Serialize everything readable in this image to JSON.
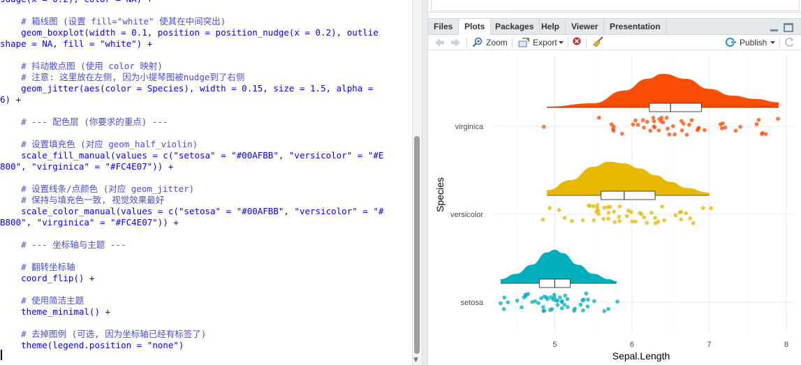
{
  "editor": {
    "lines": [
      {
        "text": "sudge(x = 0.2), color = NA) +",
        "kind": "code"
      },
      {
        "text": "",
        "kind": "code"
      },
      {
        "text": "    # 箱线图 (设置 fill=\"white\" 使其在中间突出)",
        "kind": "comment"
      },
      {
        "text": "    geom_boxplot(width = 0.1, position = position_nudge(x = 0.2), outlie",
        "kind": "code"
      },
      {
        "text": "shape = NA, fill = \"white\") +",
        "kind": "code"
      },
      {
        "text": "",
        "kind": "code"
      },
      {
        "text": "    # 抖动散点图 (使用 color 映射)",
        "kind": "comment"
      },
      {
        "text": "    # 注意: 这里放在左侧, 因为小提琴图被nudge到了右侧",
        "kind": "comment"
      },
      {
        "text": "    geom_jitter(aes(color = Species), width = 0.15, size = 1.5, alpha =",
        "kind": "code"
      },
      {
        "text": "6) +",
        "kind": "code"
      },
      {
        "text": "",
        "kind": "code"
      },
      {
        "text": "    # --- 配色层 (你要求的重点) ---",
        "kind": "comment"
      },
      {
        "text": "",
        "kind": "code"
      },
      {
        "text": "    # 设置填充色 (对应 geom_half_violin)",
        "kind": "comment"
      },
      {
        "text": "    scale_fill_manual(values = c(\"setosa\" = \"#00AFBB\", \"versicolor\" = \"#E",
        "kind": "code"
      },
      {
        "text": "800\", \"virginica\" = \"#FC4E07\")) +",
        "kind": "code"
      },
      {
        "text": "",
        "kind": "code"
      },
      {
        "text": "    # 设置线条/点颜色 (对应 geom_jitter)",
        "kind": "comment"
      },
      {
        "text": "    # 保持与填充色一致, 视觉效果最好",
        "kind": "comment"
      },
      {
        "text": "    scale_color_manual(values = c(\"setosa\" = \"#00AFBB\", \"versicolor\" = \"#",
        "kind": "code"
      },
      {
        "text": "B800\", \"virginica\" = \"#FC4E07\")) +",
        "kind": "code"
      },
      {
        "text": "",
        "kind": "code"
      },
      {
        "text": "    # --- 坐标轴与主题 ---",
        "kind": "comment"
      },
      {
        "text": "",
        "kind": "code"
      },
      {
        "text": "    # 翻转坐标轴",
        "kind": "comment"
      },
      {
        "text": "    coord_flip() +",
        "kind": "code"
      },
      {
        "text": "",
        "kind": "code"
      },
      {
        "text": "    # 使用简洁主题",
        "kind": "comment"
      },
      {
        "text": "    theme_minimal() +",
        "kind": "code"
      },
      {
        "text": "",
        "kind": "code"
      },
      {
        "text": "    # 去掉图例 (可选, 因为坐标轴已经有标签了)",
        "kind": "comment"
      },
      {
        "text": "    theme(legend.position = \"none\")",
        "kind": "code"
      }
    ]
  },
  "tabs": [
    {
      "label": "Files",
      "active": false
    },
    {
      "label": "Plots",
      "active": true
    },
    {
      "label": "Packages",
      "active": false
    },
    {
      "label": "Help",
      "active": false
    },
    {
      "label": "Viewer",
      "active": false
    },
    {
      "label": "Presentation",
      "active": false
    }
  ],
  "toolbar": {
    "zoom_label": "Zoom",
    "export_label": "Export",
    "publish_label": "Publish"
  },
  "icons": {
    "back": "arrow-left-icon",
    "forward": "arrow-right-icon",
    "zoom": "magnifier-icon",
    "export": "export-icon",
    "remove": "remove-plot-icon",
    "clear": "broom-icon",
    "publish": "publish-icon",
    "refresh": "refresh-icon",
    "minimize": "minimize-icon",
    "maximize": "maximize-icon"
  },
  "colors": {
    "setosa": "#00AFBB",
    "versicolor": "#E7B800",
    "virginica": "#FC4E07",
    "code": "#0000ff",
    "comment": "#4b4bd8"
  },
  "chart_data": {
    "type": "raincloud",
    "xlabel": "Sepal.Length",
    "ylabel": "Species",
    "xlim": [
      4.2,
      8.1
    ],
    "x_ticks": [
      5,
      6,
      7,
      8
    ],
    "grid": true,
    "legend": "none",
    "categories": [
      "setosa",
      "versicolor",
      "virginica"
    ],
    "series": [
      {
        "name": "setosa",
        "color": "#00AFBB",
        "violin": {
          "x": [
            4.3,
            4.5,
            4.7,
            4.9,
            5.0,
            5.1,
            5.3,
            5.5,
            5.7,
            5.8
          ],
          "density": [
            0.12,
            0.28,
            0.55,
            0.92,
            1.0,
            0.9,
            0.55,
            0.28,
            0.12,
            0.06
          ]
        },
        "box": {
          "q1": 4.8,
          "median": 5.0,
          "q3": 5.2
        },
        "points": [
          4.3,
          4.4,
          4.4,
          4.4,
          4.5,
          4.6,
          4.6,
          4.6,
          4.6,
          4.7,
          4.7,
          4.8,
          4.8,
          4.8,
          4.8,
          4.8,
          4.9,
          4.9,
          4.9,
          4.9,
          5.0,
          5.0,
          5.0,
          5.0,
          5.0,
          5.0,
          5.0,
          5.0,
          5.1,
          5.1,
          5.1,
          5.1,
          5.1,
          5.1,
          5.1,
          5.1,
          5.2,
          5.2,
          5.2,
          5.3,
          5.4,
          5.4,
          5.4,
          5.4,
          5.4,
          5.5,
          5.5,
          5.7,
          5.7,
          5.8
        ]
      },
      {
        "name": "versicolor",
        "color": "#E7B800",
        "violin": {
          "x": [
            4.9,
            5.2,
            5.5,
            5.7,
            5.9,
            6.1,
            6.3,
            6.5,
            6.7,
            7.0
          ],
          "density": [
            0.15,
            0.45,
            0.85,
            1.0,
            0.95,
            0.8,
            0.6,
            0.4,
            0.22,
            0.08
          ]
        },
        "box": {
          "q1": 5.6,
          "median": 5.9,
          "q3": 6.3
        },
        "points": [
          4.9,
          5.0,
          5.0,
          5.1,
          5.2,
          5.4,
          5.5,
          5.5,
          5.5,
          5.5,
          5.5,
          5.6,
          5.6,
          5.6,
          5.6,
          5.6,
          5.7,
          5.7,
          5.7,
          5.7,
          5.7,
          5.8,
          5.8,
          5.8,
          5.9,
          5.9,
          6.0,
          6.0,
          6.0,
          6.0,
          6.1,
          6.1,
          6.1,
          6.1,
          6.2,
          6.2,
          6.3,
          6.3,
          6.3,
          6.4,
          6.4,
          6.5,
          6.6,
          6.6,
          6.7,
          6.7,
          6.7,
          6.8,
          6.9,
          7.0
        ]
      },
      {
        "name": "virginica",
        "color": "#FC4E07",
        "violin": {
          "x": [
            4.9,
            5.5,
            5.9,
            6.2,
            6.4,
            6.7,
            7.0,
            7.3,
            7.6,
            7.9
          ],
          "density": [
            0.02,
            0.12,
            0.5,
            0.85,
            1.0,
            0.85,
            0.55,
            0.35,
            0.25,
            0.15
          ]
        },
        "box": {
          "q1": 6.225,
          "median": 6.5,
          "q3": 6.9
        },
        "points": [
          4.9,
          5.6,
          5.7,
          5.8,
          5.8,
          5.8,
          5.9,
          6.0,
          6.0,
          6.1,
          6.1,
          6.2,
          6.2,
          6.3,
          6.3,
          6.3,
          6.3,
          6.3,
          6.3,
          6.4,
          6.4,
          6.4,
          6.4,
          6.4,
          6.5,
          6.5,
          6.5,
          6.5,
          6.7,
          6.7,
          6.7,
          6.7,
          6.7,
          6.8,
          6.8,
          6.9,
          6.9,
          6.9,
          7.1,
          7.2,
          7.2,
          7.2,
          7.3,
          7.4,
          7.6,
          7.7,
          7.7,
          7.7,
          7.7,
          7.9
        ]
      }
    ]
  }
}
